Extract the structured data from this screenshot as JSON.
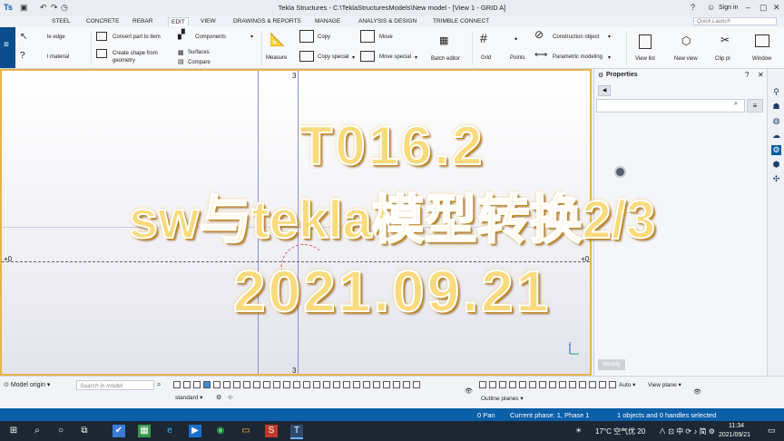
{
  "window": {
    "title": "Tekla Structures - C:\\TeklaStructuresModels\\New model - [View 1 - GRID A]",
    "signin": "Sign in"
  },
  "tabs": [
    "STEEL",
    "CONCRETE",
    "REBAR",
    "EDIT",
    "VIEW",
    "DRAWINGS & REPORTS",
    "MANAGE",
    "ANALYSIS & DESIGN",
    "TRIMBLE CONNECT"
  ],
  "quick_launch": "Quick Launch",
  "ribbon": {
    "edge": "le edge",
    "material": "l material",
    "convert": "Convert part to item",
    "create_shape_1": "Create shape from",
    "create_shape_2": "geometry",
    "components": "Components",
    "surfaces": "Surfaces",
    "compare": "Compare",
    "measure": "Measure",
    "copy": "Copy",
    "copy_special": "Copy special",
    "move": "Move",
    "move_special": "Move special",
    "batch_editor": "Batch editor",
    "grid": "Grid",
    "points": "Points",
    "construction_object": "Construction object",
    "parametric_modeling": "Parametric modeling",
    "view_list": "View list",
    "new_view": "New view",
    "clip_plane": "Clip pl",
    "window": "Window"
  },
  "viewport": {
    "grid_top": "3",
    "grid_bottom": "3",
    "elev_left": "+0",
    "elev_right": "+0"
  },
  "properties": {
    "title": "Properties",
    "modify": "Modify"
  },
  "overlay": {
    "line1": "T016.2",
    "line2": "sw与tekla模型转换2/3",
    "line3": "2021.09.21"
  },
  "bottombar": {
    "model_origin": "Model origin",
    "search_placeholder": "Search in model",
    "standard": "standard",
    "auto": "Auto",
    "view_plane": "View plane",
    "outline_planes": "Outline planes"
  },
  "status": {
    "pan": "0  Pan",
    "phase": "Current phase: 1, Phase 1",
    "selection": "1 objects and 0 handles selected"
  },
  "taskbar": {
    "weather": "17°C  空气优 20",
    "tray": "∧ ⊡ 中 ⟳ ♪ 简 ⚙",
    "time": "11:34",
    "date": "2021/09/21"
  },
  "colors": {
    "accent": "#0b5ea8",
    "view_border": "#e8b44a",
    "overlay_text": "#f9da7c"
  }
}
